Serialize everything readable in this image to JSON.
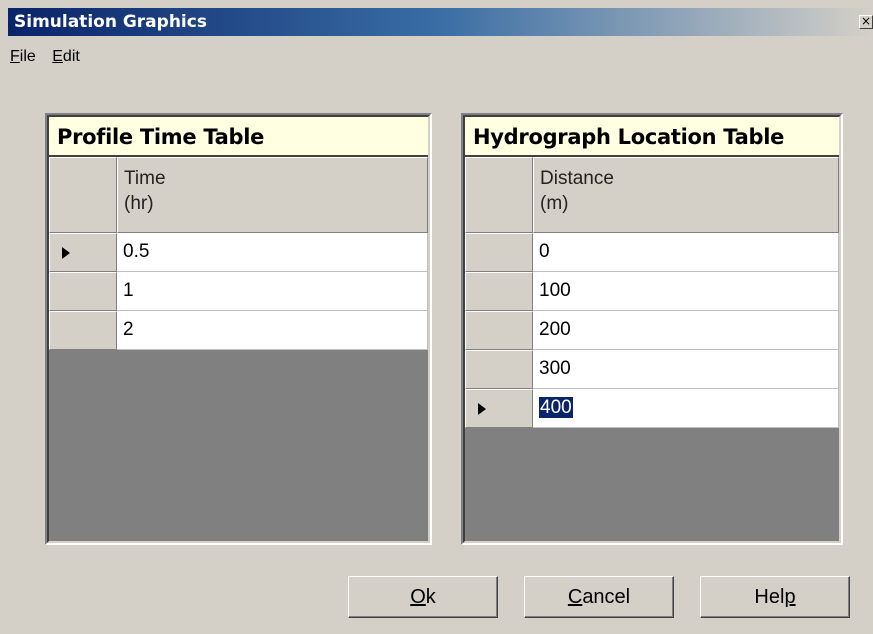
{
  "window": {
    "title": "Simulation Graphics",
    "close_glyph": "×"
  },
  "menu": [
    {
      "first": "F",
      "rest": "ile"
    },
    {
      "first": "E",
      "rest": "dit"
    }
  ],
  "profile_table": {
    "caption": "Profile Time Table",
    "header_line1": "Time",
    "header_line2": "(hr)",
    "rows": [
      "0.5",
      "1",
      "2"
    ],
    "current_row": 0
  },
  "hydrograph_table": {
    "caption": "Hydrograph Location Table",
    "header_line1": "Distance",
    "header_line2": "(m)",
    "rows": [
      "0",
      "100",
      "200",
      "300",
      "400"
    ],
    "current_row": 4,
    "selected_row": 4
  },
  "buttons": {
    "ok": {
      "pre": "",
      "ul": "O",
      "post": "k"
    },
    "cancel": {
      "pre": "",
      "ul": "C",
      "post": "ancel"
    },
    "help": {
      "pre": "Hel",
      "ul": "p",
      "post": ""
    }
  },
  "colors": {
    "title_start": "#0a246a",
    "caption_bg": "#ffffe1",
    "selection": "#0a246a"
  }
}
